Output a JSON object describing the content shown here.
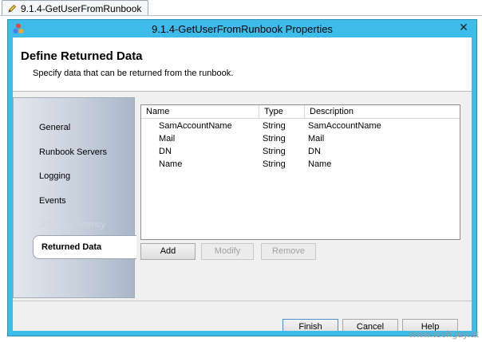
{
  "doc_tab": {
    "label": "9.1.4-GetUserFromRunbook",
    "icon": "pencil-icon"
  },
  "window": {
    "title": "9.1.4-GetUserFromRunbook Properties",
    "close_glyph": "✕",
    "icon": "orchestrator-app-icon",
    "accent": "#3dbbe9"
  },
  "header": {
    "title": "Define Returned Data",
    "subtitle": "Specify data that can be returned from the runbook."
  },
  "sidebar": {
    "items": [
      {
        "label": "General",
        "enabled": true
      },
      {
        "label": "Runbook Servers",
        "enabled": true
      },
      {
        "label": "Logging",
        "enabled": true
      },
      {
        "label": "Events",
        "enabled": true
      },
      {
        "label": "Job Concurrency",
        "enabled": false
      },
      {
        "label": "Returned Data",
        "selected": true
      }
    ]
  },
  "table": {
    "columns": [
      "Name",
      "Type",
      "Description"
    ],
    "rows": [
      {
        "name": "SamAccountName",
        "type": "String",
        "description": "SamAccountName"
      },
      {
        "name": "Mail",
        "type": "String",
        "description": "Mail"
      },
      {
        "name": "DN",
        "type": "String",
        "description": "DN"
      },
      {
        "name": "Name",
        "type": "String",
        "description": "Name"
      }
    ]
  },
  "actions": {
    "add": "Add",
    "modify": "Modify",
    "remove": "Remove"
  },
  "footer": {
    "finish": "Finish",
    "cancel": "Cancel",
    "help": "Help"
  },
  "watermark": "www.techguy.at"
}
